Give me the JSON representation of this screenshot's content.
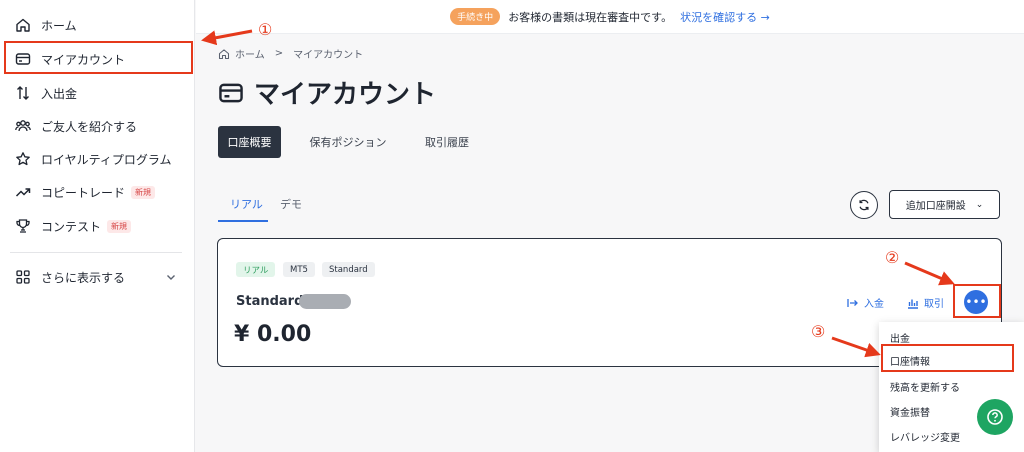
{
  "sidebar": {
    "items": [
      {
        "label": "ホーム",
        "icon": "home-icon"
      },
      {
        "label": "マイアカウント",
        "icon": "card-icon"
      },
      {
        "label": "入出金",
        "icon": "transfer-arrows-icon"
      },
      {
        "label": "ご友人を紹介する",
        "icon": "people-icon"
      },
      {
        "label": "ロイヤルティプログラム",
        "icon": "star-icon"
      },
      {
        "label": "コピートレード",
        "icon": "trend-up-icon",
        "badge": "新規"
      },
      {
        "label": "コンテスト",
        "icon": "trophy-icon",
        "badge": "新規"
      },
      {
        "label": "さらに表示する",
        "icon": "grid-icon"
      }
    ]
  },
  "banner": {
    "pill": "手続き中",
    "message": "お客様の書類は現在審査中です。",
    "link": "状況を確認する →"
  },
  "breadcrumb": {
    "home": "ホーム",
    "separator": ">",
    "current": "マイアカウント"
  },
  "page": {
    "title": "マイアカウント"
  },
  "tabs": [
    {
      "label": "口座概要",
      "active": true
    },
    {
      "label": "保有ポジション",
      "active": false
    },
    {
      "label": "取引履歴",
      "active": false
    }
  ],
  "subtabs": [
    {
      "label": "リアル",
      "active": true
    },
    {
      "label": "デモ",
      "active": false
    }
  ],
  "open_account_button": {
    "label": "追加口座開設",
    "chevron": "⌄"
  },
  "account_card": {
    "tags": [
      "リアル",
      "MT5",
      "Standard"
    ],
    "name": "Standard",
    "balance": "¥ 0.00",
    "deposit_label": "入金",
    "trade_label": "取引",
    "more_glyph": "•••"
  },
  "dropdown": {
    "items": [
      "出金",
      "口座情報",
      "残高を更新する",
      "資金振替",
      "レバレッジ変更"
    ]
  },
  "annotations": {
    "step1": "①",
    "step2": "②",
    "step3": "③",
    "color": "#e5391b"
  },
  "colors": {
    "accent": "#2f6fe0",
    "dark": "#2b3340",
    "success": "#1ea562",
    "highlight": "#e5391b"
  }
}
